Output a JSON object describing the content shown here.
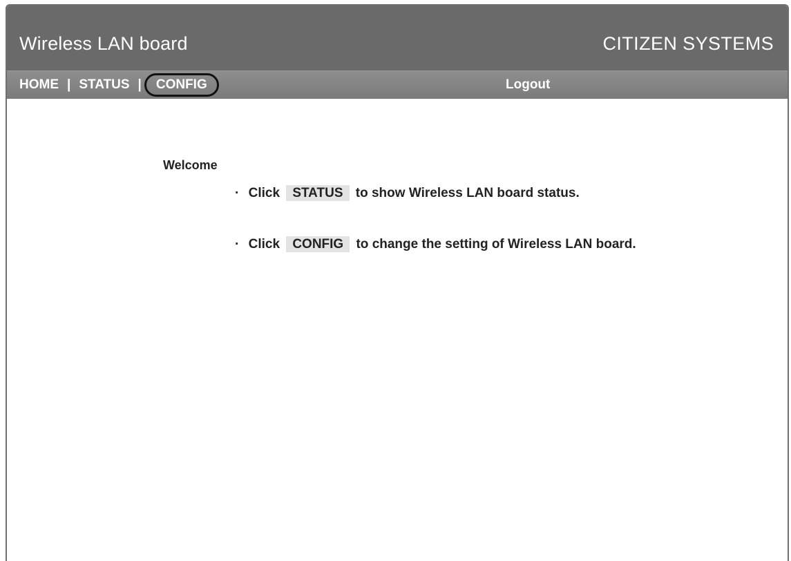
{
  "header": {
    "app_title": "Wireless LAN board",
    "brand": "CITIZEN SYSTEMS"
  },
  "nav": {
    "home": "HOME",
    "separator": "|",
    "status": "STATUS",
    "config": "CONFIG",
    "logout": "Logout"
  },
  "main": {
    "welcome": "Welcome",
    "bullet_symbol": "·",
    "items": [
      {
        "prefix": "Click",
        "button": "STATUS",
        "suffix": "to show Wireless LAN board status."
      },
      {
        "prefix": "Click",
        "button": "CONFIG",
        "suffix": "to change the setting of Wireless LAN board."
      }
    ]
  },
  "colors": {
    "header_bg": "#6a6a6a",
    "navbar_bg": "#858585",
    "chip_bg": "#e3e3e3",
    "text": "#222222"
  }
}
